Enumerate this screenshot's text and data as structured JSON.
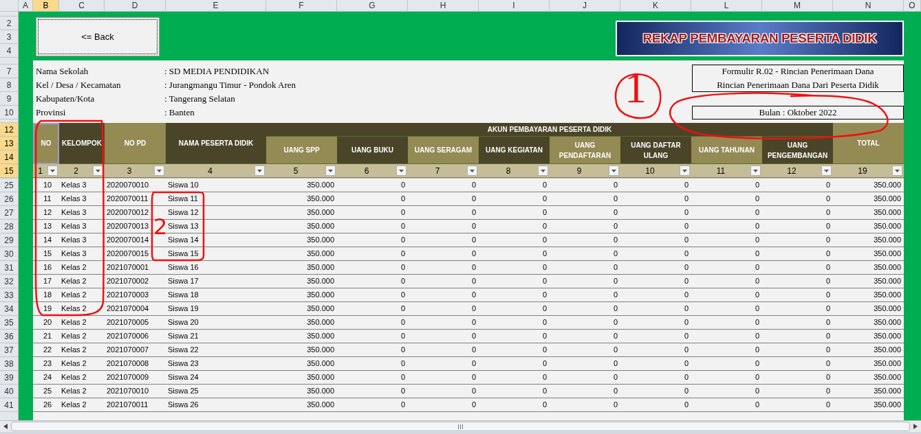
{
  "column_letters": [
    {
      "label": "A",
      "selected": false
    },
    {
      "label": "B",
      "selected": true
    },
    {
      "label": "C",
      "selected": false
    },
    {
      "label": "D",
      "selected": false
    },
    {
      "label": "E",
      "selected": false
    },
    {
      "label": "F",
      "selected": false
    },
    {
      "label": "G",
      "selected": false
    },
    {
      "label": "H",
      "selected": false
    },
    {
      "label": "I",
      "selected": false
    },
    {
      "label": "J",
      "selected": false
    },
    {
      "label": "K",
      "selected": false
    },
    {
      "label": "L",
      "selected": false
    },
    {
      "label": "M",
      "selected": false
    },
    {
      "label": "N",
      "selected": false
    },
    {
      "label": "O",
      "selected": false
    }
  ],
  "row_headers": [
    {
      "label": "2",
      "selected": false
    },
    {
      "label": "3",
      "selected": false
    },
    {
      "label": "4",
      "selected": false
    },
    {
      "label": "7",
      "selected": false
    },
    {
      "label": "8",
      "selected": false
    },
    {
      "label": "9",
      "selected": false
    },
    {
      "label": "10",
      "selected": false
    },
    {
      "label": "12",
      "selected": true
    },
    {
      "label": "13",
      "selected": true
    },
    {
      "label": "14",
      "selected": true
    },
    {
      "label": "15",
      "selected": true
    }
  ],
  "back_button": "<= Back",
  "banner_title": "REKAP PEMBAYARAN PESERTA DIDIK",
  "school_info": [
    {
      "label": "Nama Sekolah",
      "value": ": SD MEDIA PENDIDIKAN"
    },
    {
      "label": "Kel / Desa / Kecamatan",
      "value": ": Jurangmangu Timur - Pondok Aren"
    },
    {
      "label": "Kabupaten/Kota",
      "value": ": Tangerang Selatan"
    },
    {
      "label": "Provinsi",
      "value": ": Banten"
    }
  ],
  "form_box": [
    "Formulir R.02 - Rincian Penerimaan Dana",
    "Rincian Penerimaan Dana Dari Peserta Didik"
  ],
  "month_box": "Bulan : Oktober 2022",
  "table": {
    "group_header": "AKUN PEMBAYARAN PESERTA DIDIK",
    "columns": [
      {
        "label": "NO",
        "filter_label": "1",
        "selected": true
      },
      {
        "label": "KELOMPOK",
        "filter_label": "2",
        "selected": false
      },
      {
        "label": "NO PD",
        "filter_label": "3",
        "selected": false
      },
      {
        "label": "NAMA PESERTA DIDIK",
        "filter_label": "4",
        "selected": false
      },
      {
        "label": "UANG SPP",
        "filter_label": "5",
        "selected": false
      },
      {
        "label": "UANG BUKU",
        "filter_label": "6",
        "selected": false
      },
      {
        "label": "UANG SERAGAM",
        "filter_label": "7",
        "selected": false
      },
      {
        "label": "UANG KEGIATAN",
        "filter_label": "8",
        "selected": false
      },
      {
        "label": "UANG PENDAFTARAN",
        "filter_label": "9",
        "selected": false
      },
      {
        "label": "UANG DAFTAR ULANG",
        "filter_label": "10",
        "selected": false
      },
      {
        "label": "UANG TAHUNAN",
        "filter_label": "11",
        "selected": false
      },
      {
        "label": "UANG PENGEMBANGAN",
        "filter_label": "12",
        "selected": false
      },
      {
        "label": "TOTAL",
        "filter_label": "19",
        "selected": false
      }
    ],
    "rows": [
      {
        "row_number": "25",
        "cells": [
          "10",
          "Kelas 3",
          "2020070010",
          "Siswa 10",
          "350.000",
          "0",
          "0",
          "0",
          "0",
          "0",
          "0",
          "0",
          "350.000"
        ]
      },
      {
        "row_number": "26",
        "cells": [
          "11",
          "Kelas 3",
          "2020070011",
          "Siswa 11",
          "350.000",
          "0",
          "0",
          "0",
          "0",
          "0",
          "0",
          "0",
          "350.000"
        ]
      },
      {
        "row_number": "27",
        "cells": [
          "12",
          "Kelas 3",
          "2020070012",
          "Siswa 12",
          "350.000",
          "0",
          "0",
          "0",
          "0",
          "0",
          "0",
          "0",
          "350.000"
        ]
      },
      {
        "row_number": "28",
        "cells": [
          "13",
          "Kelas 3",
          "2020070013",
          "Siswa 13",
          "350.000",
          "0",
          "0",
          "0",
          "0",
          "0",
          "0",
          "0",
          "350.000"
        ]
      },
      {
        "row_number": "29",
        "cells": [
          "14",
          "Kelas 3",
          "2020070014",
          "Siswa 14",
          "350.000",
          "0",
          "0",
          "0",
          "0",
          "0",
          "0",
          "0",
          "350.000"
        ]
      },
      {
        "row_number": "30",
        "cells": [
          "15",
          "Kelas 3",
          "2020070015",
          "Siswa 15",
          "350.000",
          "0",
          "0",
          "0",
          "0",
          "0",
          "0",
          "0",
          "350.000"
        ]
      },
      {
        "row_number": "31",
        "cells": [
          "16",
          "Kelas 2",
          "2021070001",
          "Siswa 16",
          "350.000",
          "0",
          "0",
          "0",
          "0",
          "0",
          "0",
          "0",
          "350.000"
        ]
      },
      {
        "row_number": "32",
        "cells": [
          "17",
          "Kelas 2",
          "2021070002",
          "Siswa 17",
          "350.000",
          "0",
          "0",
          "0",
          "0",
          "0",
          "0",
          "0",
          "350.000"
        ]
      },
      {
        "row_number": "33",
        "cells": [
          "18",
          "Kelas 2",
          "2021070003",
          "Siswa 18",
          "350.000",
          "0",
          "0",
          "0",
          "0",
          "0",
          "0",
          "0",
          "350.000"
        ]
      },
      {
        "row_number": "34",
        "cells": [
          "19",
          "Kelas 2",
          "2021070004",
          "Siswa 19",
          "350.000",
          "0",
          "0",
          "0",
          "0",
          "0",
          "0",
          "0",
          "350.000"
        ]
      },
      {
        "row_number": "35",
        "cells": [
          "20",
          "Kelas 2",
          "2021070005",
          "Siswa 20",
          "350.000",
          "0",
          "0",
          "0",
          "0",
          "0",
          "0",
          "0",
          "350.000"
        ]
      },
      {
        "row_number": "36",
        "cells": [
          "21",
          "Kelas 2",
          "2021070006",
          "Siswa 21",
          "350.000",
          "0",
          "0",
          "0",
          "0",
          "0",
          "0",
          "0",
          "350.000"
        ]
      },
      {
        "row_number": "37",
        "cells": [
          "22",
          "Kelas 2",
          "2021070007",
          "Siswa 22",
          "350.000",
          "0",
          "0",
          "0",
          "0",
          "0",
          "0",
          "0",
          "350.000"
        ]
      },
      {
        "row_number": "38",
        "cells": [
          "23",
          "Kelas 2",
          "2021070008",
          "Siswa 23",
          "350.000",
          "0",
          "0",
          "0",
          "0",
          "0",
          "0",
          "0",
          "350.000"
        ]
      },
      {
        "row_number": "39",
        "cells": [
          "24",
          "Kelas 2",
          "2021070009",
          "Siswa 24",
          "350.000",
          "0",
          "0",
          "0",
          "0",
          "0",
          "0",
          "0",
          "350.000"
        ]
      },
      {
        "row_number": "40",
        "cells": [
          "25",
          "Kelas 2",
          "2021070010",
          "Siswa 25",
          "350.000",
          "0",
          "0",
          "0",
          "0",
          "0",
          "0",
          "0",
          "350.000"
        ]
      },
      {
        "row_number": "41",
        "cells": [
          "26",
          "Kelas 2",
          "2021070011",
          "Siswa 26",
          "350.000",
          "0",
          "0",
          "0",
          "0",
          "0",
          "0",
          "0",
          "350.000"
        ]
      }
    ]
  },
  "annotations": [
    {
      "kind": "mark",
      "text": "1"
    },
    {
      "kind": "mark",
      "text": "2"
    }
  ]
}
